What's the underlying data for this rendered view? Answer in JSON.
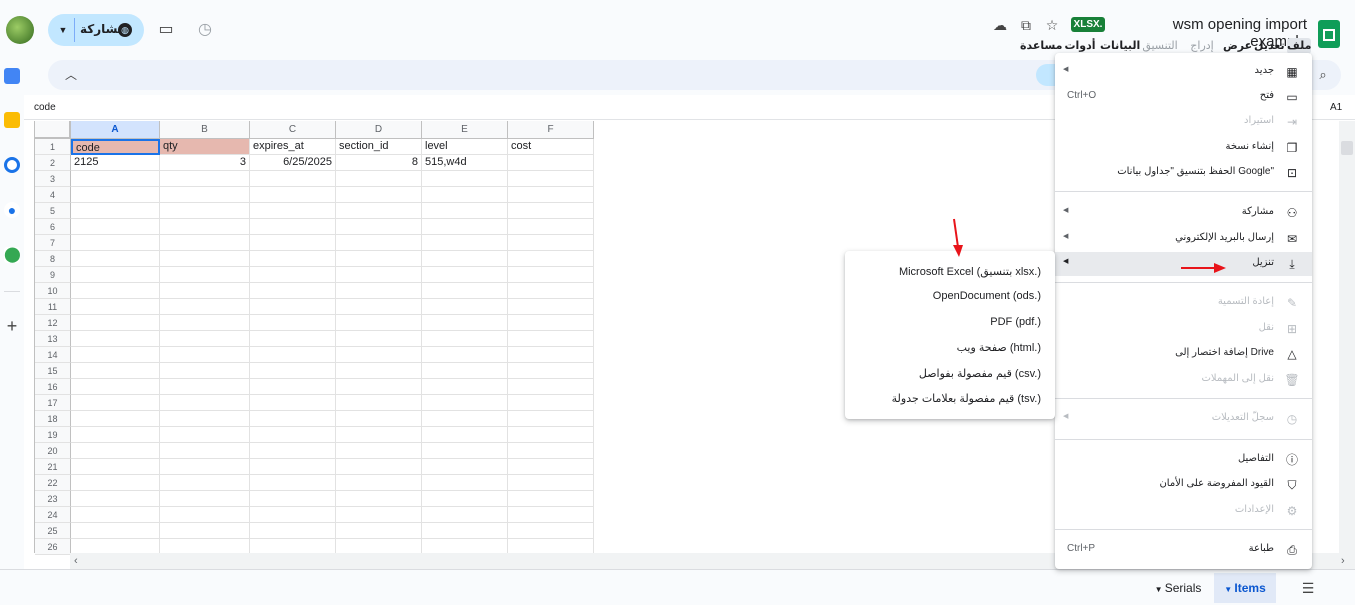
{
  "header": {
    "doc_title": "wsm opening import example",
    "format_badge": "XLSX.",
    "share_label": "مشاركة",
    "menu": [
      "ملف",
      "تعديل",
      "عرض",
      "إدراج",
      "التنسيق",
      "البيانات",
      "أدوات",
      "مساعدة"
    ]
  },
  "formula_bar": {
    "cell_ref": "A1",
    "value": "code"
  },
  "grid": {
    "columns": [
      "A",
      "B",
      "C",
      "D",
      "E",
      "F"
    ],
    "row_numbers": [
      "1",
      "2",
      "3",
      "4",
      "5",
      "6",
      "7",
      "8",
      "9",
      "10",
      "11",
      "12",
      "13",
      "14",
      "15",
      "16",
      "17",
      "18",
      "19",
      "20",
      "21",
      "22",
      "23",
      "24",
      "25",
      "26"
    ],
    "row1": [
      "code",
      "qty",
      "expires_at",
      "section_id",
      "level",
      "cost"
    ],
    "row2": [
      "2125",
      "3",
      "6/25/2025",
      "8",
      "515,w4d",
      ""
    ]
  },
  "file_menu": {
    "new": "جديد",
    "open": "فتح",
    "open_shortcut": "Ctrl+O",
    "import": "استيراد",
    "make_copy": "إنشاء نسخة",
    "save_as_sheets": "الحفظ بتنسيق \"جداول بيانات Google\"",
    "share": "مشاركة",
    "email": "إرسال بالبريد الإلكتروني",
    "download": "تنزيل",
    "rename": "إعادة التسمية",
    "move": "نقل",
    "add_shortcut": "إضافة اختصار إلى Drive",
    "move_to_trash": "نقل إلى المهملات",
    "version_history": "سجلّ التعديلات",
    "details": "التفاصيل",
    "security": "القيود المفروضة على الأمان",
    "settings": "الإعدادات",
    "print": "طباعة",
    "print_shortcut": "Ctrl+P"
  },
  "download_submenu": [
    "Microsoft Excel (بتنسيق xlsx.)",
    "OpenDocument (ods.)",
    "PDF (pdf.)",
    "صفحة ويب (html.)",
    "قيم مفصولة بفواصل (csv.)",
    "قيم مفصولة بعلامات جدولة (tsv.)"
  ],
  "sheet_tabs": {
    "tab1": "Serials",
    "tab2": "Items"
  },
  "colors": {
    "accent": "#0b57d0",
    "header_pink": "#e6b8af",
    "annotation_red": "#e8141a",
    "brand_green": "#0f9d58"
  }
}
